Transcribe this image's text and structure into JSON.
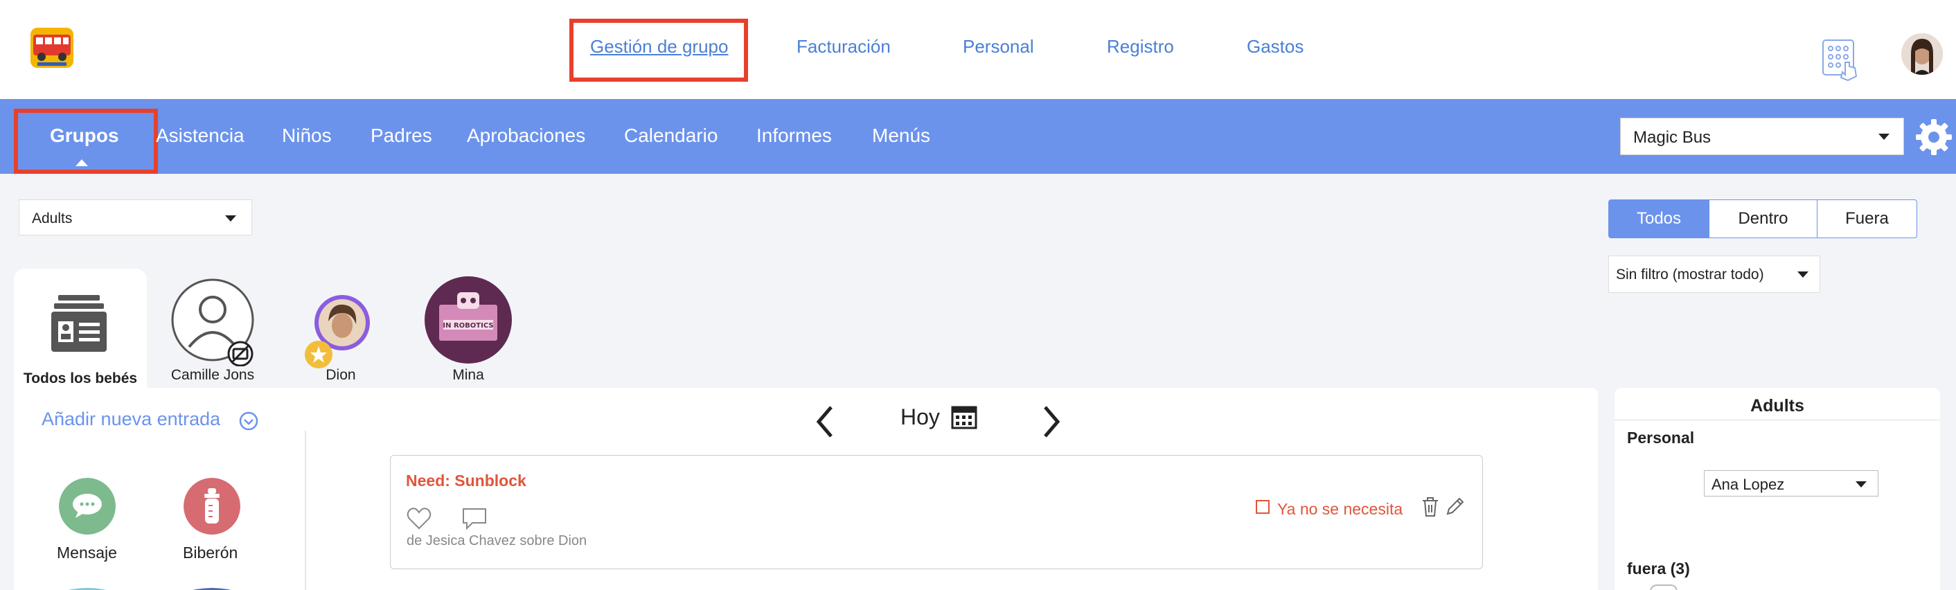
{
  "topnav": {
    "items": [
      {
        "label": "Gestión de grupo",
        "active": true
      },
      {
        "label": "Facturación"
      },
      {
        "label": "Personal"
      },
      {
        "label": "Registro"
      },
      {
        "label": "Gastos"
      }
    ]
  },
  "subnav": {
    "items": [
      {
        "label": "Grupos",
        "active": true
      },
      {
        "label": "Asistencia"
      },
      {
        "label": "Niños"
      },
      {
        "label": "Padres"
      },
      {
        "label": "Aprobaciones"
      },
      {
        "label": "Calendario"
      },
      {
        "label": "Informes"
      },
      {
        "label": "Menús"
      }
    ],
    "school_select": "Magic Bus"
  },
  "filters": {
    "group_select": "Adults",
    "segments": [
      "Todos",
      "Dentro",
      "Fuera"
    ],
    "filter_select": "Sin filtro (mostrar todo)"
  },
  "children": [
    {
      "label": "Todos los bebés"
    },
    {
      "label": "Camille Jons"
    },
    {
      "label": "Dion"
    },
    {
      "label": "Mina"
    }
  ],
  "main": {
    "add_entry": "Añadir nueva entrada",
    "date_label": "Hoy",
    "entry_types": [
      {
        "label": "Mensaje"
      },
      {
        "label": "Biberón"
      }
    ],
    "entry": {
      "title": "Need: Sunblock",
      "status": "Ya no se necesita",
      "byline": "de Jesica Chavez sobre Dion"
    }
  },
  "right_panel": {
    "title": "Adults",
    "staff_label": "Personal",
    "staff_select": "Ana Lopez",
    "out_label": "fuera (3)"
  },
  "colors": {
    "accent": "#6b93ec",
    "highlight": "#e8402c",
    "need": "#e0553a"
  }
}
